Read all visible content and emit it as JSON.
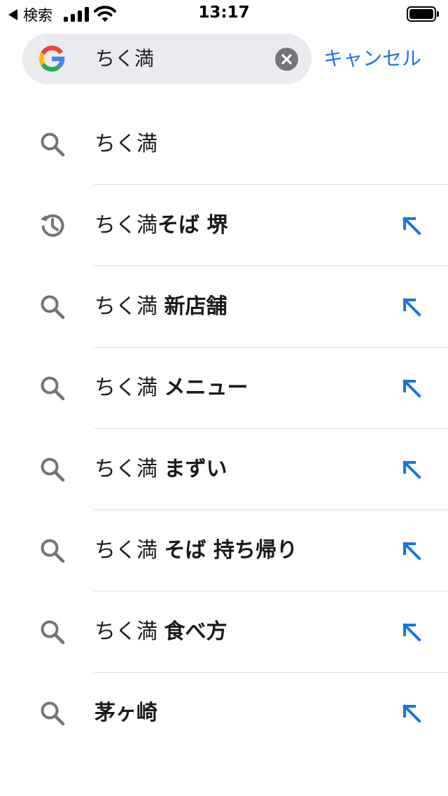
{
  "status_bar": {
    "back_label": "検索",
    "time": "13:17"
  },
  "search": {
    "query": "ちく満",
    "cancel_label": "キャンセル"
  },
  "suggestions": [
    {
      "icon": "search-icon",
      "base": "ちく満",
      "bold": "",
      "fill": false
    },
    {
      "icon": "history-icon",
      "base": "ちく満",
      "bold": "そば 堺",
      "fill": true
    },
    {
      "icon": "search-icon",
      "base": "ちく満 ",
      "bold": "新店舗",
      "fill": true
    },
    {
      "icon": "search-icon",
      "base": "ちく満 ",
      "bold": "メニュー",
      "fill": true
    },
    {
      "icon": "search-icon",
      "base": "ちく満 ",
      "bold": "まずい",
      "fill": true
    },
    {
      "icon": "search-icon",
      "base": "ちく満 ",
      "bold": "そば 持ち帰り",
      "fill": true
    },
    {
      "icon": "search-icon",
      "base": "ちく満 ",
      "bold": "食べ方",
      "fill": true
    },
    {
      "icon": "search-icon",
      "base": "",
      "bold": "茅ヶ崎",
      "fill": true
    }
  ],
  "colors": {
    "accent": "#1a73e8",
    "icon_gray": "#70757a",
    "search_bg": "#eaebee"
  }
}
